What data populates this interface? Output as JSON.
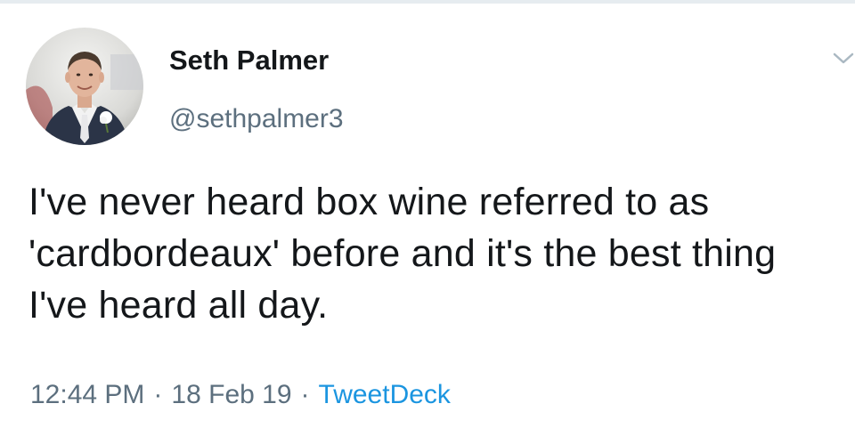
{
  "tweet": {
    "display_name": "Seth Palmer",
    "handle": "@sethpalmer3",
    "text": "I've never heard box wine referred to as 'cardbordeaux' before and it's the best thing I've heard all day.",
    "time": "12:44 PM",
    "separator": "·",
    "date": "18 Feb 19",
    "source": "TweetDeck",
    "avatar_icon": "profile-photo-man-in-suit",
    "menu_icon": "chevron-down-icon"
  },
  "colors": {
    "text": "#14171a",
    "secondary": "#5c6f7e",
    "link": "#1b95e0",
    "divider": "#e6ecf0"
  }
}
